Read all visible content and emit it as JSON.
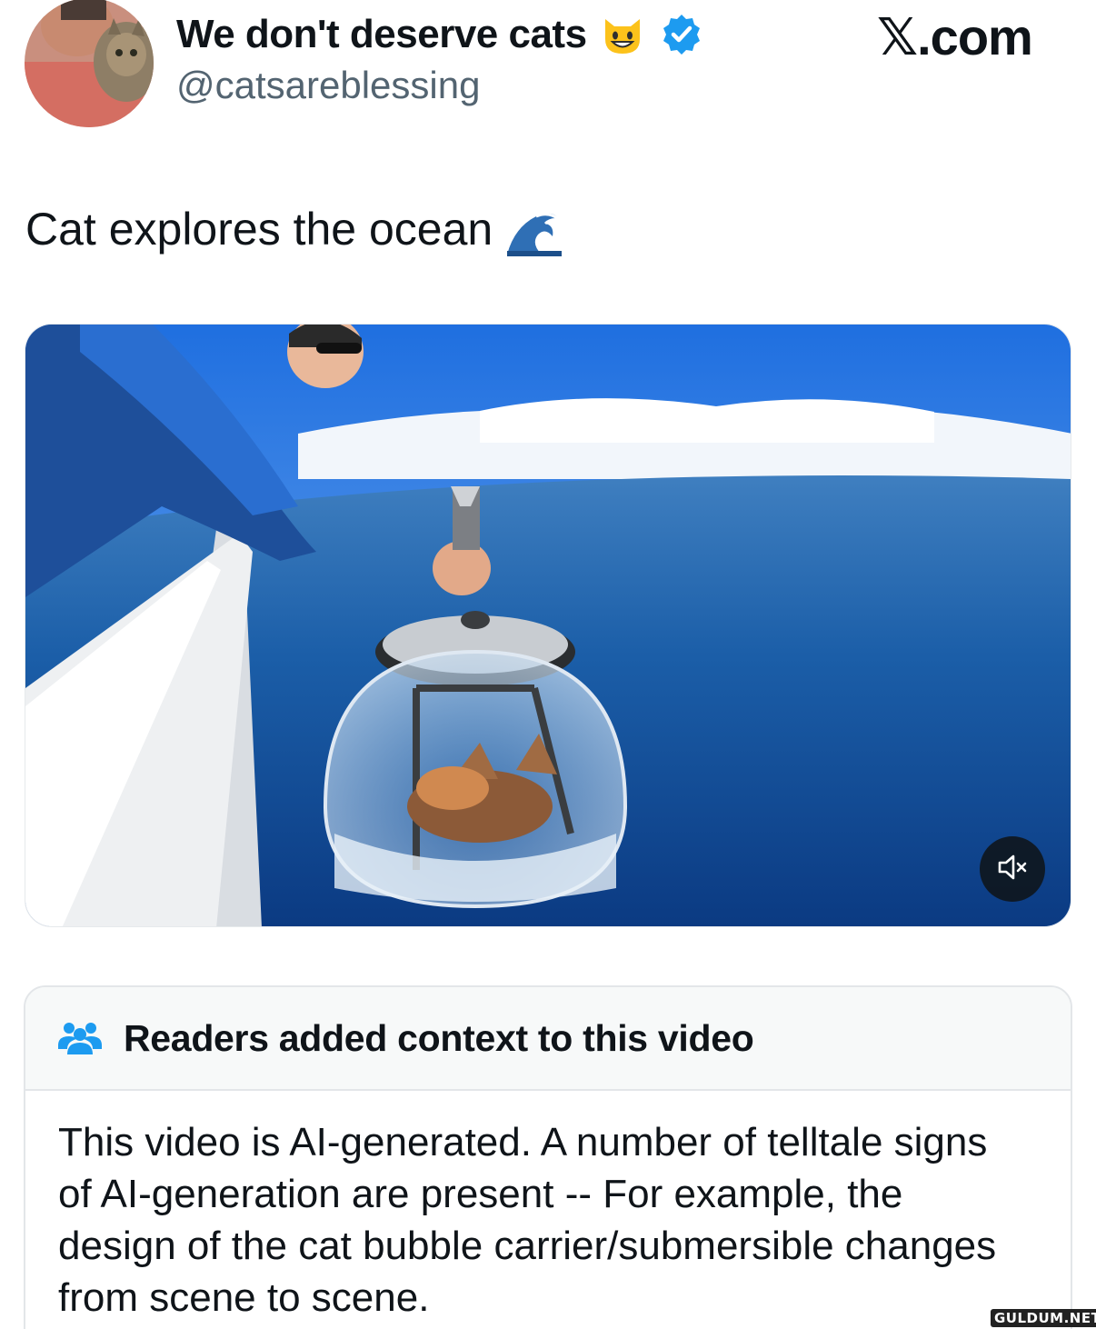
{
  "colors": {
    "verified_badge": "#1d9bf0",
    "handle_text": "#536471",
    "note_icon": "#1d9bf0",
    "note_header_bg": "#f7f9f9"
  },
  "header": {
    "display_name": "We don't deserve cats",
    "emoji_icon": "grinning-cat-emoji",
    "verified_icon": "verified-badge-icon",
    "handle": "@catsareblessing",
    "site_label": "𝕏.com"
  },
  "tweet": {
    "text": "Cat explores the ocean",
    "emoji_icon": "water-wave-emoji"
  },
  "media": {
    "type": "video",
    "mute_icon": "speaker-muted-icon"
  },
  "community_note": {
    "icon": "people-group-icon",
    "title": "Readers added context to this video",
    "body": "This video is AI-generated. A number of telltale signs of AI-generation are present -- For example, the design of the cat bubble carrier/submersible changes from scene to scene."
  },
  "watermark": "GULDUM.NET"
}
